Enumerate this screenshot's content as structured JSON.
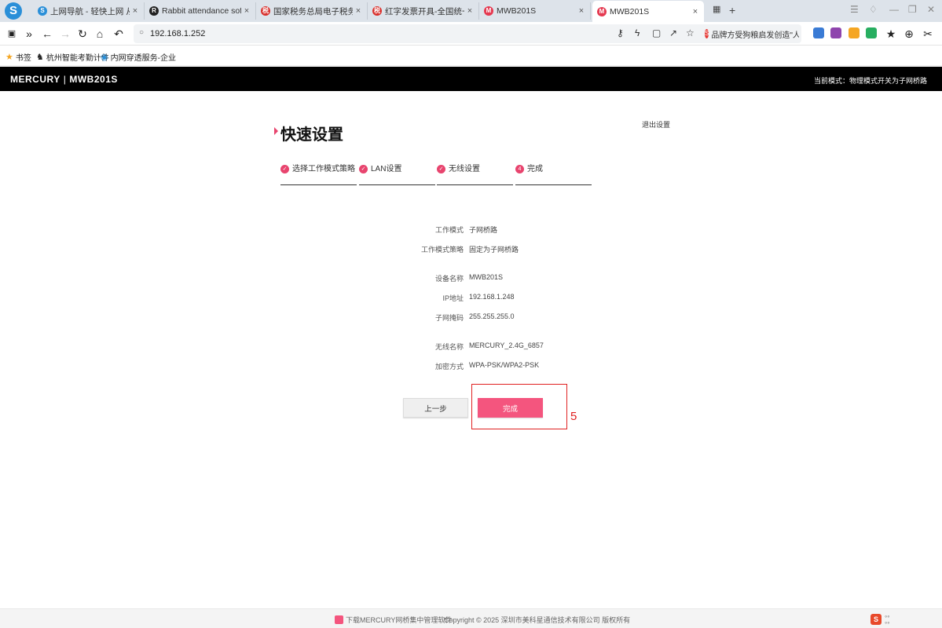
{
  "browser": {
    "logo_letter": "S",
    "tabs": [
      {
        "label": "上网导航 - 轻快上网 从这里开始",
        "close": "×",
        "icon_color": "#2a8fd8",
        "icon_char": "S"
      },
      {
        "label": "Rabbit attendance software",
        "close": "×",
        "icon_color": "#222222",
        "icon_char": "R"
      },
      {
        "label": "国家税务总局电子税务局",
        "close": "×",
        "icon_color": "#d9302c",
        "icon_char": "税"
      },
      {
        "label": "红字发票开具-全国统一规范电子",
        "close": "×",
        "icon_color": "#d9302c",
        "icon_char": "税"
      },
      {
        "label": "MWB201S",
        "close": "×",
        "icon_color": "#e53950",
        "icon_char": "M"
      },
      {
        "label": "MWB201S",
        "close": "×",
        "icon_color": "#e53950",
        "icon_char": "M"
      }
    ],
    "new_tab": "+",
    "address": "192.168.1.252",
    "search_engine_text": "品牌方受狗粮启发创造\"人"
  },
  "bookmarks": [
    {
      "label": "书签",
      "icon": "star-icon"
    },
    {
      "label": "杭州智能考勤计件",
      "icon": "rabbit-icon"
    },
    {
      "label": "内网穿透服务-企业",
      "icon": "globe-icon"
    }
  ],
  "router": {
    "brand": "MERCURY",
    "model": "MWB201S",
    "mode_status": "当前模式：物理模式开关为子网桥路",
    "page_title": "快速设置",
    "exit_label": "退出设置",
    "steps": [
      {
        "label": "选择工作模式策略",
        "mark": "✓"
      },
      {
        "label": "LAN设置",
        "mark": "✓"
      },
      {
        "label": "无线设置",
        "mark": "✓"
      },
      {
        "label": "完成",
        "mark": "4"
      }
    ],
    "summary": {
      "work_mode_label": "工作模式",
      "work_mode": "子网桥路",
      "strategy_label": "工作模式策略",
      "strategy": "固定为子网桥路",
      "device_name_label": "设备名称",
      "device_name": "MWB201S",
      "ip_label": "IP地址",
      "ip": "192.168.1.248",
      "mask_label": "子网掩码",
      "mask": "255.255.255.0",
      "ssid_label": "无线名称",
      "ssid": "MERCURY_2.4G_6857",
      "encryption_label": "加密方式",
      "encryption": "WPA-PSK/WPA2-PSK"
    },
    "prev_button": "上一步",
    "finish_button": "完成",
    "annotation_number": "5",
    "accent_color": "#f4557e"
  },
  "footer": {
    "download_text": "下载MERCURY网桥集中管理软件",
    "copyright": "Copyright © 2025 深圳市美科星通信技术有限公司 版权所有",
    "corner_badge": "S"
  }
}
